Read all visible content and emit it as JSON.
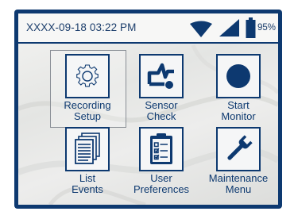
{
  "status_bar": {
    "datetime": "XXXX-09-18 03:22 PM",
    "battery_percent": "95%",
    "icons": [
      "wifi-icon",
      "signal-strength-icon",
      "battery-icon"
    ]
  },
  "menu": {
    "items": [
      {
        "line1": "Recording",
        "line2": "Setup",
        "icon": "gear-icon",
        "selected": true
      },
      {
        "line1": "Sensor",
        "line2": "Check",
        "icon": "sensor-signal-icon",
        "selected": false
      },
      {
        "line1": "Start",
        "line2": "Monitor",
        "icon": "record-dot-icon",
        "selected": false
      },
      {
        "line1": "List",
        "line2": "Events",
        "icon": "document-list-icon",
        "selected": false
      },
      {
        "line1": "User",
        "line2": "Preferences",
        "icon": "clipboard-checklist-icon",
        "selected": false
      },
      {
        "line1": "Maintenance",
        "line2": "Menu",
        "icon": "wrench-icon",
        "selected": false
      }
    ]
  },
  "colors": {
    "frame": "#0d3970",
    "text": "#0d3970",
    "screen_bg": "#ecedeb"
  }
}
